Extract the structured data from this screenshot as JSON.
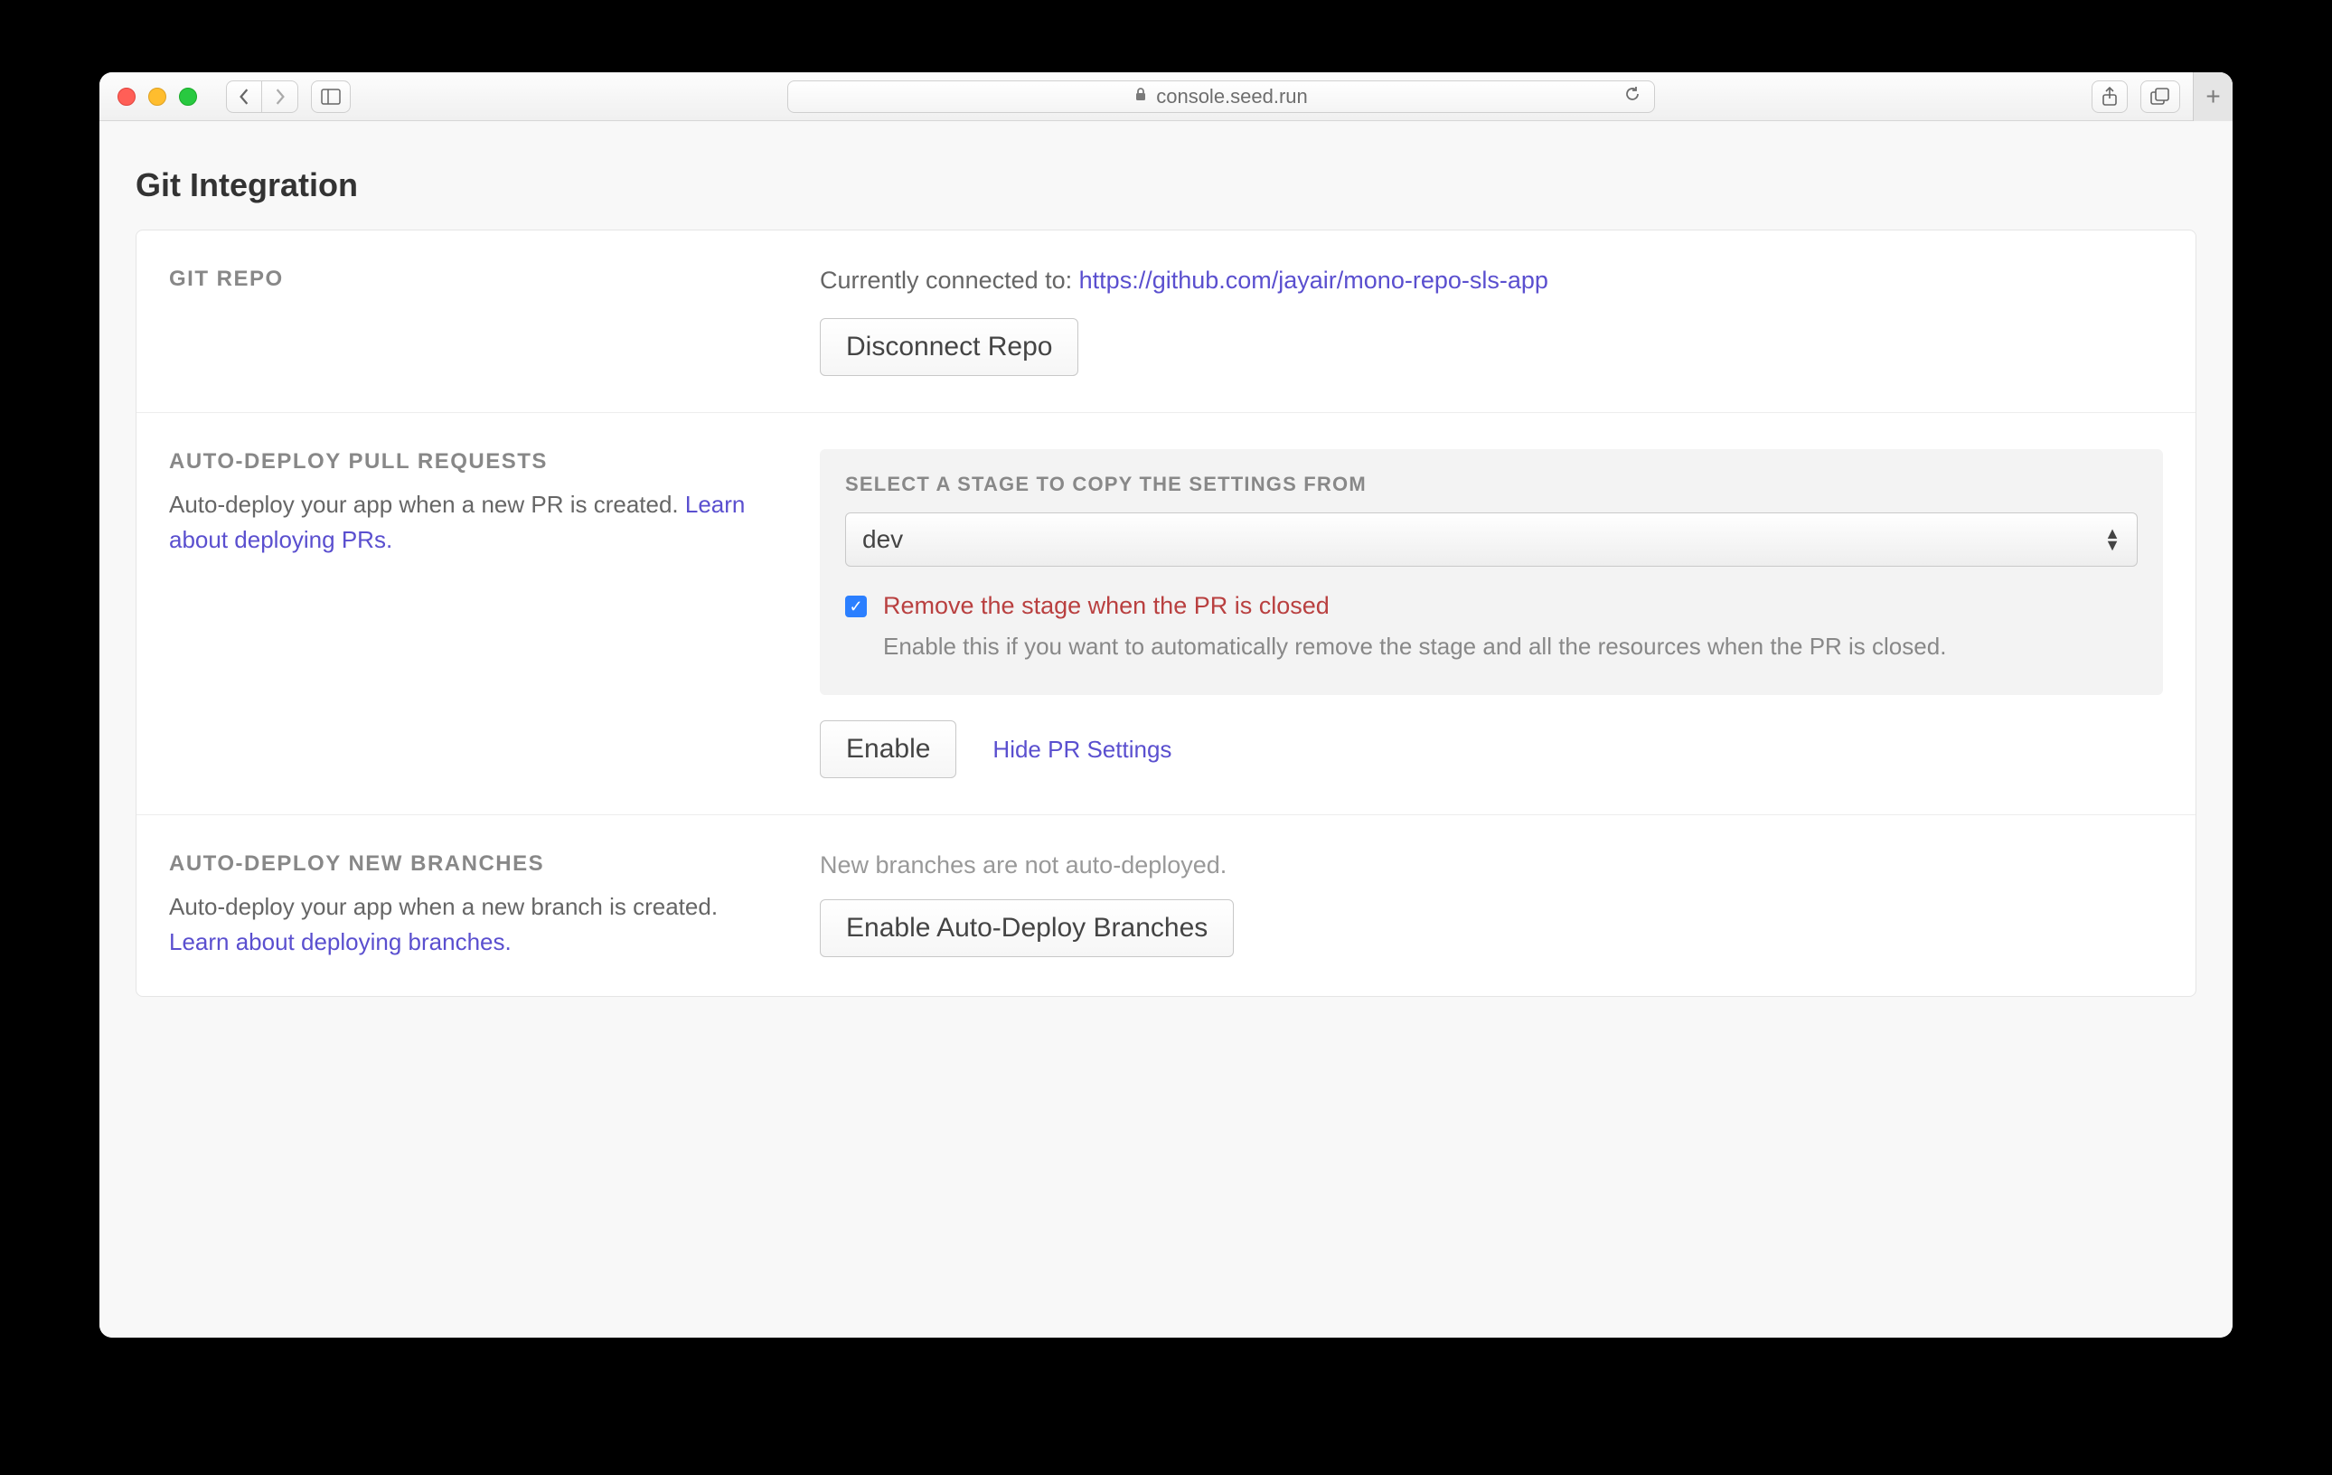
{
  "browser": {
    "url": "console.seed.run"
  },
  "page": {
    "title": "Git Integration"
  },
  "git_repo": {
    "label": "GIT REPO",
    "connected_prefix": "Currently connected to: ",
    "repo_url": "https://github.com/jayair/mono-repo-sls-app",
    "disconnect_btn": "Disconnect Repo"
  },
  "pr": {
    "label": "AUTO-DEPLOY PULL REQUESTS",
    "desc": "Auto-deploy your app when a new PR is created. ",
    "learn_link": "Learn about deploying PRs.",
    "select_label": "SELECT A STAGE TO COPY THE SETTINGS FROM",
    "select_value": "dev",
    "checkbox_title": "Remove the stage when the PR is closed",
    "checkbox_desc": "Enable this if you want to automatically remove the stage and all the resources when the PR is closed.",
    "enable_btn": "Enable",
    "hide_link": "Hide PR Settings"
  },
  "branches": {
    "label": "AUTO-DEPLOY NEW BRANCHES",
    "desc": "Auto-deploy your app when a new branch is created. ",
    "learn_link": "Learn about deploying branches.",
    "status": "New branches are not auto-deployed.",
    "enable_btn": "Enable Auto-Deploy Branches"
  }
}
